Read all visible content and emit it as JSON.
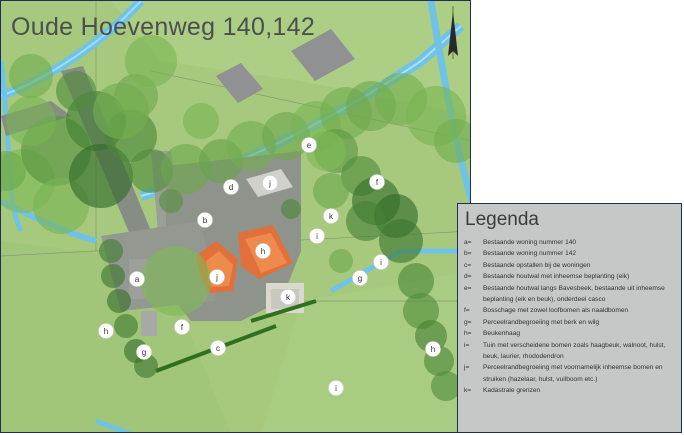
{
  "map": {
    "title": "Oude Hoevenweg 140,142",
    "colors": {
      "grass": "#a6c97e",
      "water": "#6fc3e6",
      "road": "#8a9188",
      "paving": "#8c9189",
      "house_roof": "#e2703a",
      "outbuilding": "#d9d9cf",
      "building_gray": "#8f9192",
      "tree_light": "#8fca5f",
      "tree_dark": "#1f5a1e",
      "hedge": "#2f6f1f",
      "border": "#1f2f5a"
    },
    "markers": [
      "e",
      "d",
      "j",
      "f",
      "b",
      "i",
      "i",
      "g",
      "h",
      "j",
      "a",
      "k",
      "f",
      "c",
      "g",
      "h",
      "i",
      "h",
      "k"
    ],
    "north_arrow_icon": "north-arrow-icon"
  },
  "legend": {
    "title": "Legenda",
    "items": [
      {
        "key": "a=",
        "text": "Bestaande woning nummer 140"
      },
      {
        "key": "b=",
        "text": "Bestaande woning nummer 142"
      },
      {
        "key": "c=",
        "text": "Bestaande opstallen bij de woningen"
      },
      {
        "key": "d=",
        "text": "Bestaande houtwal met inheemse beplanting (eik)"
      },
      {
        "key": "e=",
        "text": "Bestaande houtwal langs Bavesbeek, bestaande uit inheemse"
      },
      {
        "key": "",
        "text": "beplanting (eik en beuk), onderdeel casco"
      },
      {
        "key": "f=",
        "text": "Bosschage met zowel loofbomen als naaldbomen"
      },
      {
        "key": "g=",
        "text": "Perceelrandbegroeiing met berk en wilg"
      },
      {
        "key": "h=",
        "text": "Beukenhaag"
      },
      {
        "key": "i=",
        "text": "Tuin met verscheidene bomen zoals haagbeuk, walnoot, hulst,"
      },
      {
        "key": "",
        "text": "beuk, laurier, rhododendron"
      },
      {
        "key": "j=",
        "text": "Perceelrandbegroeiing met voornamelijk inheemse bomen en"
      },
      {
        "key": "",
        "text": "struiken (hazelaar, hulst, vuilboom etc.)"
      },
      {
        "key": "k=",
        "text": "Kadastrale grenzen"
      }
    ]
  }
}
